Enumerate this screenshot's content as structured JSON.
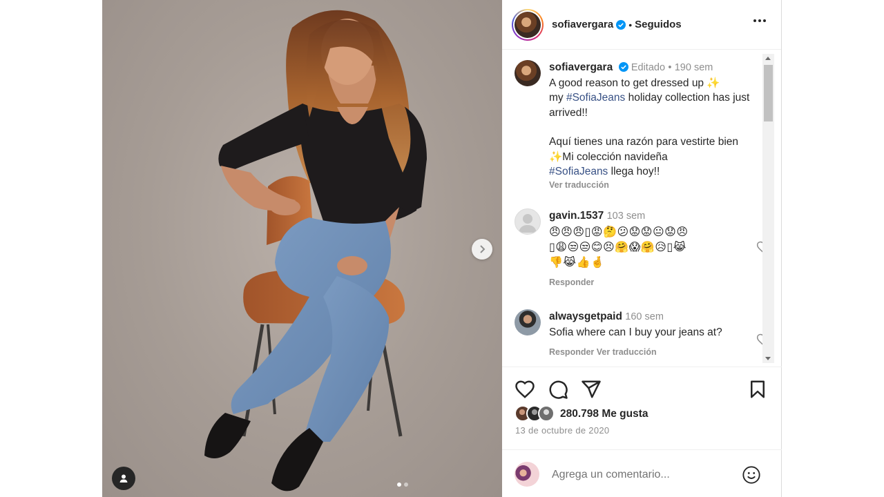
{
  "post": {
    "author": "sofiavergara",
    "follow_status": "Seguidos",
    "separator": "•"
  },
  "caption": {
    "author": "sofiavergara",
    "edited": "Editado",
    "dot": "•",
    "time": "190 sem",
    "line1": "A good reason to get dressed up ✨",
    "line2_pre": "my ",
    "hashtag1": "#SofiaJeans",
    "line2_post": " holiday collection has just arrived!!",
    "line3": "Aquí tienes una razón para vestirte bien ✨Mi colección navideña",
    "hashtag2": "#SofiaJeans",
    "line4_post": " llega hoy!!",
    "translate": "Ver traducción"
  },
  "comments": [
    {
      "user": "gavin.1537",
      "time": "103 sem",
      "text_line1": "😠😠😠▯😡🤔😕😟😟😐😟😠",
      "text_line2": "▯😩😒😒😊😣🤗😱🤗😥▯😹",
      "text_line3": "👎😹👍🤞",
      "reply": "Responder"
    },
    {
      "user": "alwaysgetpaid",
      "time": "160 sem",
      "text": "Sofia where can I buy your jeans at?",
      "reply_partial": "Responder  Ver traducción"
    }
  ],
  "engagement": {
    "likes_count": "280.798",
    "likes_label": "Me gusta",
    "date": "13 de octubre de 2020"
  },
  "add_comment": {
    "placeholder": "Agrega un comentario..."
  },
  "colors": {
    "verified": "#0095f6",
    "hashtag": "#385185",
    "muted": "#8e8e8e",
    "text": "#262626"
  },
  "icons": [
    "verified-badge-icon",
    "more-options-icon",
    "heart-icon",
    "comment-icon",
    "share-icon",
    "bookmark-icon",
    "emoji-icon",
    "chevron-right-icon",
    "user-tag-icon"
  ]
}
